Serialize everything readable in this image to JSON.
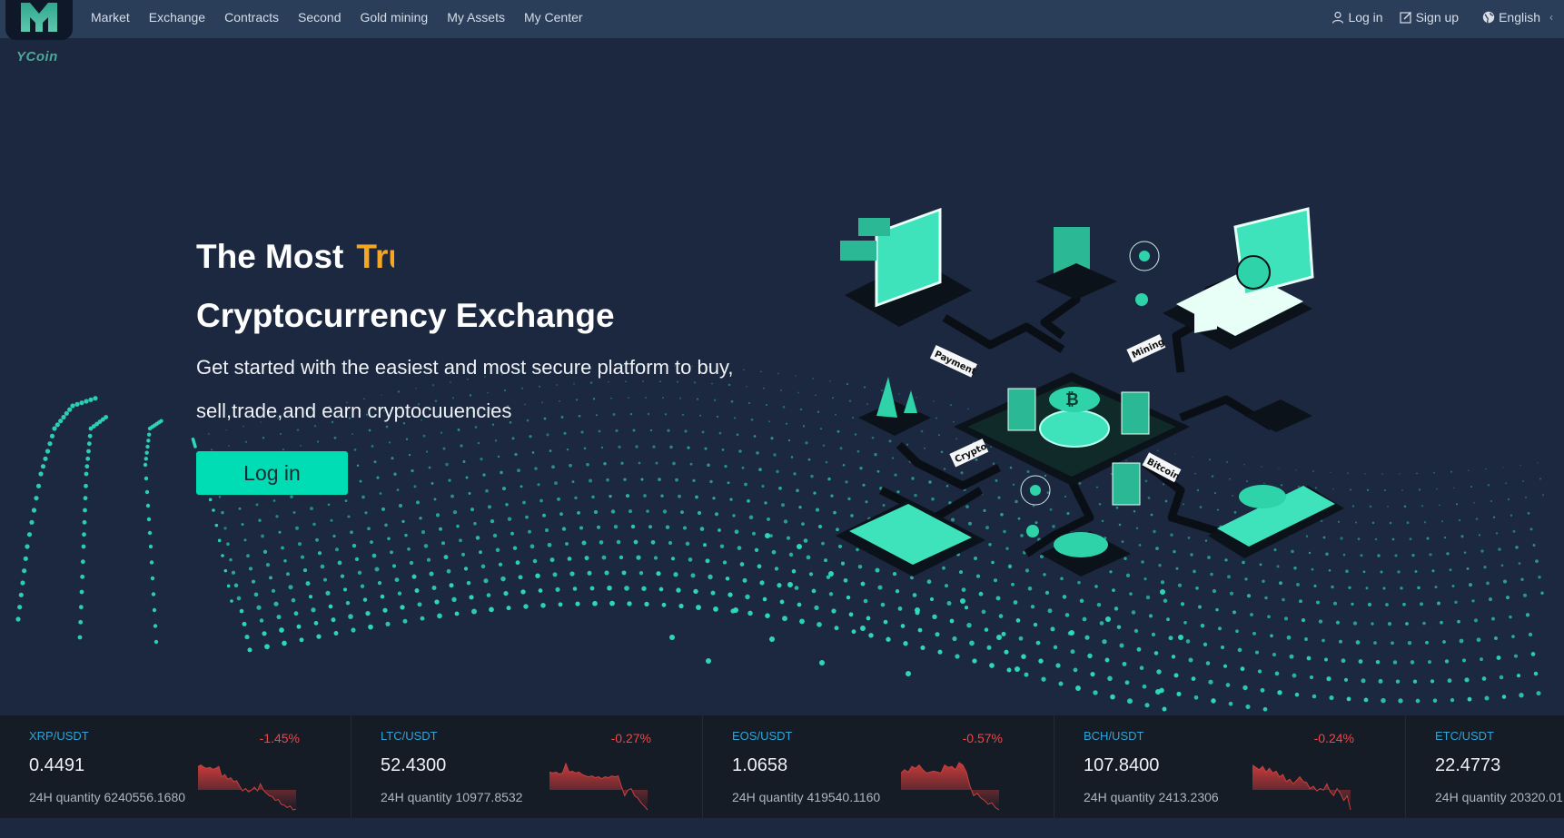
{
  "brand": {
    "name": "YCoin"
  },
  "nav": {
    "items": [
      "Market",
      "Exchange",
      "Contracts",
      "Second",
      "Gold mining",
      "My Assets",
      "My Center"
    ],
    "login_label": "Log in",
    "signup_label": "Sign up",
    "language_label": "English"
  },
  "hero": {
    "title_prefix": "The Most",
    "title_typed": "Tru",
    "title_line2": "Cryptocurrency Exchange",
    "subtitle_line1": "Get started with the easiest and most secure platform to buy,",
    "subtitle_line2": "sell,trade,and earn cryptocuuencies",
    "cta_label": "Log in",
    "illustration_labels": [
      "Payment",
      "Mining",
      "Crypto",
      "Bitcoin"
    ]
  },
  "colors": {
    "accent": "#00dcb4",
    "highlight": "#f5a623",
    "negative": "#f04545",
    "pair": "#2fa4d6",
    "header_bg": "#2a3e5a",
    "page_bg": "#1b2840"
  },
  "ticker": [
    {
      "pair": "XRP/USDT",
      "change": "-1.45%",
      "price": "0.4491",
      "qty_label": "24H quantity",
      "qty": "6240556.1680",
      "spark": [
        0.92,
        0.95,
        0.9,
        0.88,
        0.9,
        0.86,
        0.88,
        0.92,
        0.7,
        0.75,
        0.65,
        0.68,
        0.6,
        0.62,
        0.5,
        0.4,
        0.45,
        0.38,
        0.42,
        0.48,
        0.4,
        0.55,
        0.42,
        0.35,
        0.3,
        0.28,
        0.2,
        0.22,
        0.12,
        0.1,
        0.05,
        0.08,
        0.0,
        0.02
      ]
    },
    {
      "pair": "LTC/USDT",
      "change": "-0.27%",
      "price": "52.4300",
      "qty_label": "24H quantity",
      "qty": "10977.8532",
      "spark": [
        0.8,
        0.78,
        0.8,
        0.76,
        0.78,
        0.98,
        0.8,
        0.82,
        0.78,
        0.8,
        0.75,
        0.72,
        0.7,
        0.72,
        0.68,
        0.7,
        0.66,
        0.7,
        0.68,
        0.72,
        0.7,
        0.72,
        0.5,
        0.3,
        0.42,
        0.45,
        0.3,
        0.25,
        0.15,
        0.08,
        0.0
      ]
    },
    {
      "pair": "EOS/USDT",
      "change": "-0.57%",
      "price": "1.0658",
      "qty_label": "24H quantity",
      "qty": "419540.1160",
      "spark": [
        0.78,
        0.85,
        0.8,
        0.92,
        0.88,
        0.95,
        0.85,
        0.78,
        0.8,
        0.82,
        0.8,
        0.78,
        0.95,
        0.9,
        0.92,
        0.85,
        1.0,
        0.95,
        0.8,
        0.5,
        0.3,
        0.35,
        0.25,
        0.2,
        0.12,
        0.15,
        0.05,
        0.0
      ]
    },
    {
      "pair": "BCH/USDT",
      "change": "-0.24%",
      "price": "107.8400",
      "qty_label": "24H quantity",
      "qty": "2413.2306",
      "spark": [
        0.95,
        0.9,
        0.85,
        0.92,
        0.8,
        0.88,
        0.78,
        0.82,
        0.7,
        0.75,
        0.6,
        0.65,
        0.55,
        0.62,
        0.7,
        0.6,
        0.58,
        0.45,
        0.5,
        0.4,
        0.45,
        0.42,
        0.55,
        0.38,
        0.3,
        0.45,
        0.35,
        0.2,
        0.3,
        0.0
      ]
    },
    {
      "pair": "ETC/USDT",
      "change": "",
      "price": "22.4773",
      "qty_label": "24H quantity",
      "qty": "20320.01",
      "spark": []
    }
  ]
}
